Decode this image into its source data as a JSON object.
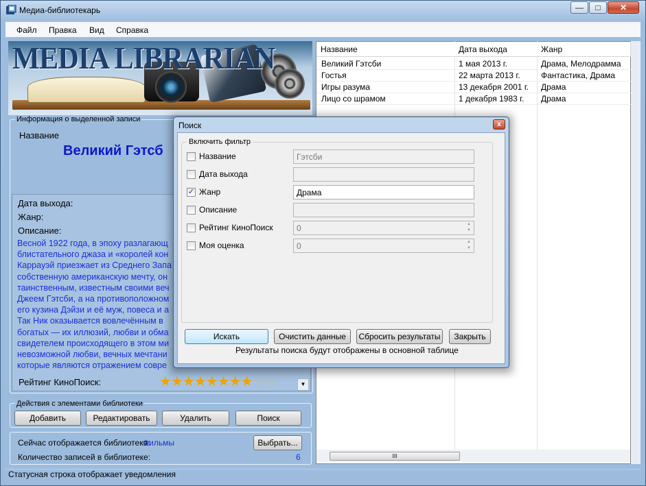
{
  "window": {
    "title": "Медиа-библиотекарь",
    "controls": {
      "minimize": "—",
      "maximize": "□",
      "close": "✕"
    }
  },
  "menu": [
    "Файл",
    "Правка",
    "Вид",
    "Справка"
  ],
  "banner": {
    "text": "MEDIA LIBRARIAN"
  },
  "info": {
    "group_title": "Информация о выделенной записи",
    "name_label": "Название",
    "name_value": "Великий Гэтсб",
    "date_label": "Дата выхода:",
    "genre_label": "Жанр:",
    "description_label": "Описание:",
    "description_lines": [
      "Весной 1922 года, в эпоху разлагающ",
      "блистательного джаза и «королей кон",
      "Каррауэй приезжает из Среднего Запа",
      "собственную американскую мечту, он",
      "таинственным, известным своими веч",
      "Джеем Гэтсби, а на противоположном",
      "его кузина Дэйзи и её муж, повеса и а",
      "Так Ник оказывается вовлечённым в",
      "богатых — их иллюзий, любви и обма",
      "свидетелем происходящего в этом ми",
      "невозможной любви, вечных мечтани",
      "которые являются отражением совре"
    ],
    "rating_label": "Рейтинг КиноПоиск:",
    "rating_value": 8,
    "rating_max": 10
  },
  "actions": {
    "group_title": "Действия с элементами библиотеки",
    "add": "Добавить",
    "edit": "Редактировать",
    "delete": "Удалить",
    "search": "Поиск"
  },
  "library": {
    "current_label": "Сейчас отображается библиотека:",
    "current_value": "Фильмы",
    "choose_button": "Выбрать...",
    "count_label": "Количество записей в библиотеке:",
    "count_value": "6"
  },
  "table": {
    "columns": [
      "Название",
      "Дата выхода",
      "Жанр"
    ],
    "rows": [
      [
        "Великий Гэтсби",
        "1 мая 2013 г.",
        "Драма, Мелодрамма"
      ],
      [
        "Гостья",
        "22 марта 2013 г.",
        "Фантастика, Драма"
      ],
      [
        "Игры разума",
        "13 декабря 2001 г.",
        "Драма"
      ],
      [
        "Лицо со шрамом",
        "1 декабря 1983 г.",
        "Драма"
      ]
    ],
    "hscroll_grip": "III"
  },
  "status_bar": "Статусная строка отображает уведомления",
  "dialog": {
    "title": "Поиск",
    "close": "x",
    "filter_group": "Включить фильтр",
    "fields": [
      {
        "label": "Название",
        "value": "Гэтсби",
        "checked": false
      },
      {
        "label": "Дата выхода",
        "value": "",
        "checked": false
      },
      {
        "label": "Жанр",
        "value": "Драма",
        "checked": true
      },
      {
        "label": "Описание",
        "value": "",
        "checked": false
      },
      {
        "label": "Рейтинг КиноПоиск",
        "value": "0",
        "checked": false
      },
      {
        "label": "Моя оценка",
        "value": "0",
        "checked": false
      }
    ],
    "buttons": {
      "search": "Искать",
      "clear": "Очистить данные",
      "reset": "Сбросить результаты",
      "close": "Закрыть"
    },
    "note": "Результаты поиска будут отображены в основной таблице"
  }
}
